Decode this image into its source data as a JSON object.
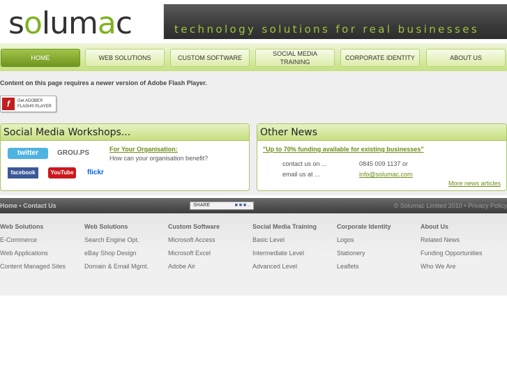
{
  "header": {
    "logo_text_pre": "s",
    "logo_text_o": "o",
    "logo_text_post": "lum",
    "logo_text_a": "a",
    "logo_text_c": "c",
    "tagline": "technology solutions for real businesses"
  },
  "nav": {
    "items": [
      {
        "label": "HOME"
      },
      {
        "label": "WEB SOLUTIONS"
      },
      {
        "label": "CUSTOM SOFTWARE"
      },
      {
        "label": "SOCIAL MEDIA TRAINING"
      },
      {
        "label": "CORPORATE IDENTITY"
      },
      {
        "label": "ABOUT US"
      }
    ]
  },
  "flash": {
    "message": "Content on this page requires a newer version of Adobe Flash Player.",
    "button_line1": "Get ADOBE®",
    "button_line2": "FLASH® PLAYER"
  },
  "social_panel": {
    "title": "Social Media Workshops...",
    "icons": [
      "twitter",
      "GROU.PS",
      "facebook",
      "YouTube",
      "flickr"
    ],
    "link": "For Your Organisation:",
    "text": "How can your organisation benefit?"
  },
  "news_panel": {
    "title": "Other News",
    "headline": "\"Up to 70% funding available for existing businesses\"",
    "contact_label": "contact us on ...",
    "contact_value": "0845 009 1137 or",
    "email_label": "email us at ...",
    "email_value": "info@solumac.com",
    "more_link": "More news articles"
  },
  "footer": {
    "home": "Home",
    "separator": "•",
    "contact": "Contact Us",
    "share": "SHARE",
    "copyright": "© Solumac Limited 2010 • Privacy Policy"
  },
  "sitemap": {
    "columns": [
      {
        "heading": "Web Solutions",
        "items": [
          "E-Commerce",
          "Web Applications",
          "Content Managed Sites"
        ]
      },
      {
        "heading": "Web Solutions",
        "items": [
          "Search Engine Opt.",
          "eBay Shop Design",
          "Domain & Email Mgmt."
        ]
      },
      {
        "heading": "Custom Software",
        "items": [
          "Microsoft Access",
          "Microsoft Excel",
          "Adobe Air"
        ]
      },
      {
        "heading": "Social Media Training",
        "items": [
          "Basic Level",
          "Intermediate Level",
          "Advanced Level"
        ]
      },
      {
        "heading": "Corporate Identity",
        "items": [
          "Logos",
          "Stationery",
          "Leaflets"
        ]
      },
      {
        "heading": "About Us",
        "items": [
          "Related News",
          "Funding Opportunities",
          "Who We Are"
        ]
      }
    ]
  },
  "colors": {
    "brand_green": "#7fb21f",
    "header_dark": "#3a3a3a",
    "nav_active": "#6f9420"
  }
}
